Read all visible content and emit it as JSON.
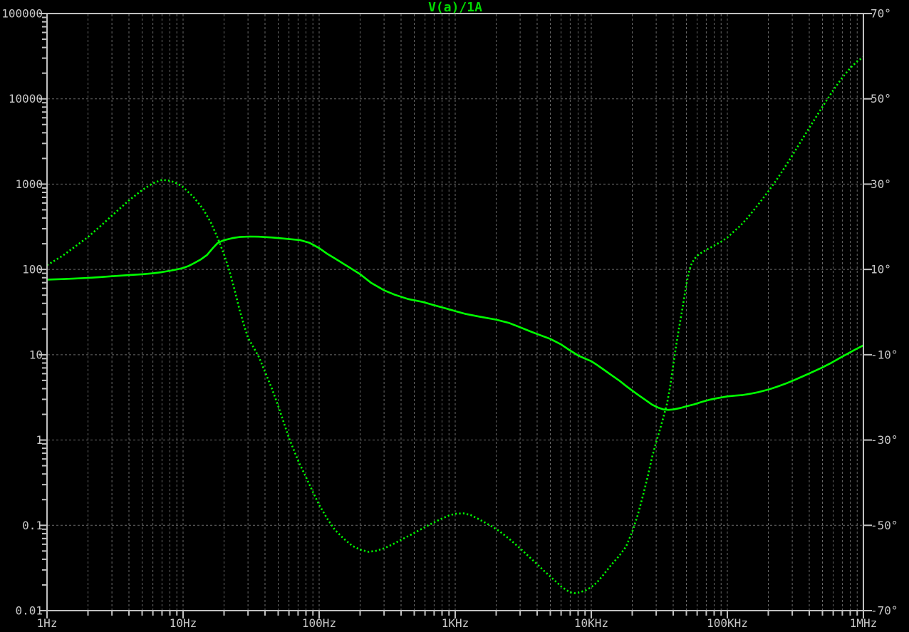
{
  "chart_data": {
    "type": "line",
    "title": "V(a)/1A",
    "grid": true,
    "background": "#000000",
    "colors": {
      "trace": "#00ff00",
      "title": "#00dc00",
      "grid": "#6a6a6a",
      "axis": "#c0c0c0",
      "label": "#c8c8c8"
    },
    "x_axis": {
      "scale": "log",
      "unit": "Hz",
      "lim": [
        1,
        1000000
      ],
      "tick_labels": [
        "1Hz",
        "10Hz",
        "100Hz",
        "1KHz",
        "10KHz",
        "100KHz",
        "1MHz"
      ],
      "tick_values": [
        1,
        10,
        100,
        1000,
        10000,
        100000,
        1000000
      ]
    },
    "y_axis_left": {
      "scale": "log",
      "unit": "ohms",
      "lim": [
        0.01,
        100000
      ],
      "tick_labels": [
        "100000",
        "10000",
        "1000",
        "100",
        "10",
        "1",
        "0.1",
        "0.01"
      ],
      "tick_values": [
        100000,
        10000,
        1000,
        100,
        10,
        1,
        0.1,
        0.01
      ]
    },
    "y_axis_right": {
      "scale": "linear",
      "unit": "degrees",
      "lim": [
        -70,
        70
      ],
      "tick_labels": [
        "70°",
        "50°",
        "30°",
        "10°",
        "-10°",
        "-30°",
        "-50°",
        "-70°"
      ],
      "tick_values": [
        70,
        50,
        30,
        10,
        -10,
        -30,
        -50,
        -70
      ]
    },
    "series": [
      {
        "name": "magnitude",
        "axis": "left",
        "style": "solid",
        "color": "#00ff00",
        "points": [
          [
            1,
            76
          ],
          [
            1.3,
            77
          ],
          [
            1.6,
            78.2
          ],
          [
            2,
            79.6
          ],
          [
            2.5,
            81.4
          ],
          [
            3,
            83.2
          ],
          [
            4,
            85.8
          ],
          [
            5,
            87.8
          ],
          [
            6,
            90
          ],
          [
            7,
            93
          ],
          [
            8,
            96.5
          ],
          [
            9,
            100
          ],
          [
            10,
            104
          ],
          [
            11,
            110
          ],
          [
            12,
            118
          ],
          [
            13.5,
            131
          ],
          [
            15,
            148
          ],
          [
            16.5,
            177
          ],
          [
            18,
            205
          ],
          [
            20,
            220
          ],
          [
            23,
            233
          ],
          [
            26,
            240
          ],
          [
            31,
            243
          ],
          [
            36,
            242
          ],
          [
            45,
            237
          ],
          [
            55,
            230
          ],
          [
            72,
            221
          ],
          [
            85,
            205
          ],
          [
            100,
            178
          ],
          [
            115,
            152
          ],
          [
            130,
            135
          ],
          [
            160,
            110
          ],
          [
            200,
            88
          ],
          [
            240,
            70
          ],
          [
            300,
            57
          ],
          [
            360,
            50.5
          ],
          [
            450,
            45
          ],
          [
            580,
            41.5
          ],
          [
            700,
            38
          ],
          [
            850,
            35
          ],
          [
            1000,
            32.5
          ],
          [
            1200,
            30
          ],
          [
            1500,
            28
          ],
          [
            2000,
            25.8
          ],
          [
            2500,
            23.5
          ],
          [
            3000,
            21
          ],
          [
            3500,
            19
          ],
          [
            4000,
            17.5
          ],
          [
            5000,
            15.3
          ],
          [
            6000,
            13.2
          ],
          [
            7000,
            11.2
          ],
          [
            8000,
            9.8
          ],
          [
            9000,
            9
          ],
          [
            10000,
            8.4
          ],
          [
            11000,
            7.6
          ],
          [
            12500,
            6.6
          ],
          [
            14000,
            5.8
          ],
          [
            16000,
            5
          ],
          [
            18000,
            4.3
          ],
          [
            20000,
            3.8
          ],
          [
            22000,
            3.4
          ],
          [
            25000,
            2.95
          ],
          [
            28000,
            2.6
          ],
          [
            31000,
            2.4
          ],
          [
            34000,
            2.28
          ],
          [
            37000,
            2.26
          ],
          [
            40000,
            2.28
          ],
          [
            45000,
            2.37
          ],
          [
            50000,
            2.48
          ],
          [
            57000,
            2.62
          ],
          [
            65000,
            2.8
          ],
          [
            75000,
            2.98
          ],
          [
            85000,
            3.1
          ],
          [
            100000,
            3.25
          ],
          [
            115000,
            3.32
          ],
          [
            130000,
            3.37
          ],
          [
            150000,
            3.5
          ],
          [
            170000,
            3.65
          ],
          [
            200000,
            3.9
          ],
          [
            230000,
            4.2
          ],
          [
            270000,
            4.6
          ],
          [
            310000,
            5.05
          ],
          [
            360000,
            5.6
          ],
          [
            420000,
            6.25
          ],
          [
            490000,
            7
          ],
          [
            570000,
            7.9
          ],
          [
            660000,
            9
          ],
          [
            760000,
            10.2
          ],
          [
            880000,
            11.6
          ],
          [
            1000000,
            12.9
          ]
        ]
      },
      {
        "name": "phase",
        "axis": "right",
        "style": "dotted",
        "color": "#00ff00",
        "points": [
          [
            1,
            11
          ],
          [
            1.3,
            13.2
          ],
          [
            1.6,
            15.3
          ],
          [
            2,
            17.6
          ],
          [
            2.5,
            20.3
          ],
          [
            3,
            22.6
          ],
          [
            4,
            26.2
          ],
          [
            5,
            28.6
          ],
          [
            6,
            30.2
          ],
          [
            7,
            31
          ],
          [
            8,
            30.8
          ],
          [
            9,
            30.2
          ],
          [
            10,
            29.3
          ],
          [
            12,
            26.9
          ],
          [
            14,
            24.2
          ],
          [
            16,
            21
          ],
          [
            18,
            17.3
          ],
          [
            20,
            13.5
          ],
          [
            22,
            9.5
          ],
          [
            24,
            5
          ],
          [
            26,
            0.5
          ],
          [
            28,
            -3
          ],
          [
            30,
            -6
          ],
          [
            33,
            -8.3
          ],
          [
            36,
            -10.5
          ],
          [
            40,
            -14
          ],
          [
            45,
            -18
          ],
          [
            50,
            -22
          ],
          [
            60,
            -29.5
          ],
          [
            70,
            -34.8
          ],
          [
            80,
            -38.7
          ],
          [
            90,
            -42.2
          ],
          [
            100,
            -45.2
          ],
          [
            115,
            -48.5
          ],
          [
            130,
            -51
          ],
          [
            150,
            -53
          ],
          [
            175,
            -54.8
          ],
          [
            200,
            -55.7
          ],
          [
            230,
            -56.2
          ],
          [
            260,
            -56
          ],
          [
            300,
            -55.4
          ],
          [
            350,
            -54.4
          ],
          [
            400,
            -53.4
          ],
          [
            500,
            -51.8
          ],
          [
            600,
            -50.4
          ],
          [
            700,
            -49.3
          ],
          [
            800,
            -48.4
          ],
          [
            900,
            -47.7
          ],
          [
            1000,
            -47.3
          ],
          [
            1150,
            -47.2
          ],
          [
            1300,
            -47.6
          ],
          [
            1500,
            -48.6
          ],
          [
            1800,
            -50
          ],
          [
            2100,
            -51.3
          ],
          [
            2500,
            -53.2
          ],
          [
            3000,
            -55.4
          ],
          [
            3500,
            -57.4
          ],
          [
            4000,
            -59.1
          ],
          [
            4500,
            -60.7
          ],
          [
            5000,
            -62
          ],
          [
            5500,
            -63.2
          ],
          [
            6000,
            -64.3
          ],
          [
            6500,
            -65.1
          ],
          [
            7000,
            -65.7
          ],
          [
            7500,
            -65.9
          ],
          [
            8000,
            -65.8
          ],
          [
            9000,
            -65.3
          ],
          [
            10000,
            -64.5
          ],
          [
            11000,
            -63.4
          ],
          [
            12000,
            -62
          ],
          [
            14000,
            -59.3
          ],
          [
            16000,
            -57.2
          ],
          [
            18000,
            -55
          ],
          [
            20000,
            -51.5
          ],
          [
            22000,
            -47.5
          ],
          [
            24000,
            -43
          ],
          [
            26000,
            -38.5
          ],
          [
            28000,
            -34
          ],
          [
            30000,
            -30.5
          ],
          [
            32000,
            -27.5
          ],
          [
            34000,
            -24.5
          ],
          [
            36000,
            -21.5
          ],
          [
            38000,
            -17.5
          ],
          [
            40000,
            -12.5
          ],
          [
            42000,
            -8
          ],
          [
            44000,
            -4
          ],
          [
            46000,
            -0.5
          ],
          [
            48000,
            3
          ],
          [
            50000,
            6.5
          ],
          [
            52000,
            9.2
          ],
          [
            54000,
            11
          ],
          [
            57000,
            12.4
          ],
          [
            60000,
            13.2
          ],
          [
            65000,
            14
          ],
          [
            72000,
            14.8
          ],
          [
            80000,
            15.6
          ],
          [
            90000,
            16.5
          ],
          [
            100000,
            17.5
          ],
          [
            110000,
            18.7
          ],
          [
            125000,
            20.3
          ],
          [
            140000,
            22
          ],
          [
            160000,
            24.3
          ],
          [
            180000,
            26.4
          ],
          [
            200000,
            28.3
          ],
          [
            230000,
            31
          ],
          [
            260000,
            33.6
          ],
          [
            300000,
            36.7
          ],
          [
            350000,
            40.2
          ],
          [
            400000,
            43.2
          ],
          [
            460000,
            46.3
          ],
          [
            520000,
            49
          ],
          [
            600000,
            52
          ],
          [
            700000,
            55
          ],
          [
            800000,
            57.2
          ],
          [
            900000,
            58.8
          ],
          [
            1000000,
            59.8
          ]
        ]
      }
    ]
  }
}
